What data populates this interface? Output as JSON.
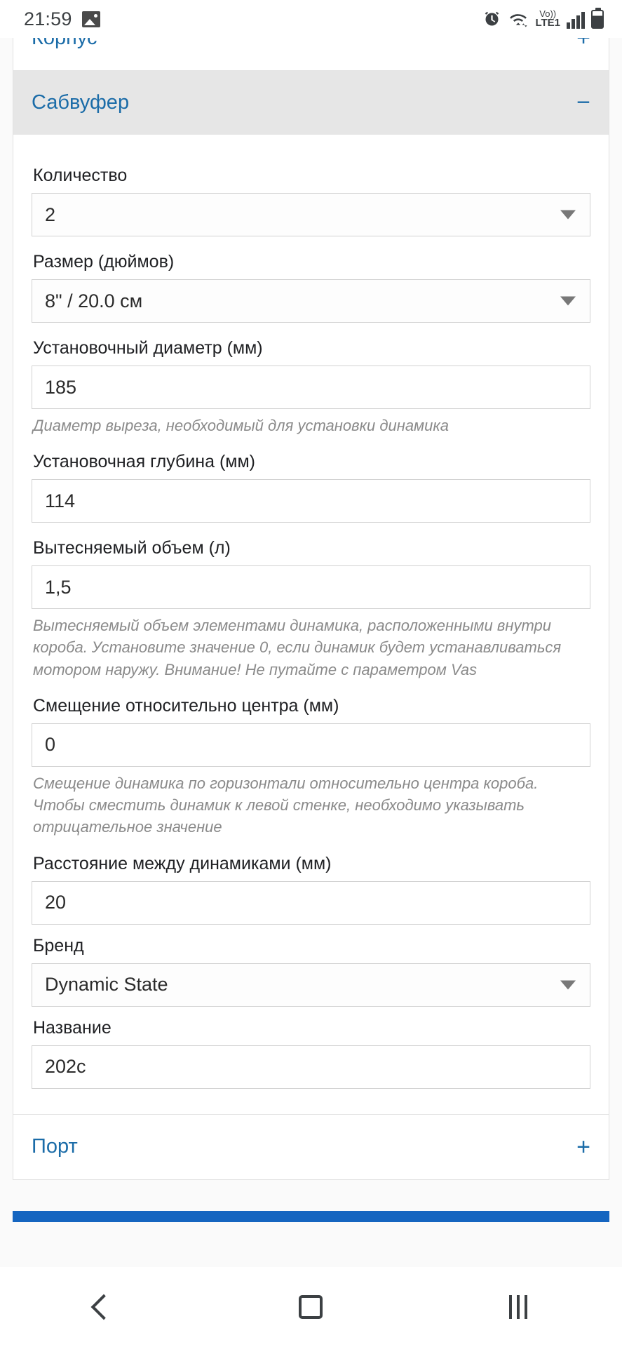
{
  "statusbar": {
    "time": "21:59",
    "icons": [
      "image-icon",
      "alarm-icon",
      "wifi-icon",
      "volte-icon",
      "signal-icon",
      "battery-icon"
    ],
    "volte_top": "Vo))",
    "volte_bottom": "LTE1"
  },
  "panels": {
    "enclosure": {
      "title": "Корпус",
      "sign": "+"
    },
    "subwoofer": {
      "title": "Сабвуфер",
      "sign": "−"
    },
    "port": {
      "title": "Порт",
      "sign": "+"
    }
  },
  "fields": {
    "quantity": {
      "label": "Количество",
      "value": "2",
      "type": "select"
    },
    "size": {
      "label": "Размер (дюймов)",
      "value": "8\" / 20.0 см",
      "type": "select"
    },
    "mount_diameter": {
      "label": "Установочный диаметр (мм)",
      "value": "185",
      "type": "text",
      "hint": "Диаметр выреза, необходимый для установки динамика"
    },
    "mount_depth": {
      "label": "Установочная глубина (мм)",
      "value": "114",
      "type": "text"
    },
    "displaced_volume": {
      "label": "Вытесняемый объем (л)",
      "value": "1,5",
      "type": "text",
      "hint": "Вытесняемый объем элементами динамика, расположенными внутри короба. Установите значение 0, если динамик будет устанавливаться мотором наружу. Внимание! Не путайте с параметром Vas"
    },
    "center_offset": {
      "label": "Смещение относительно центра (мм)",
      "value": "0",
      "type": "text",
      "hint": "Смещение динамика по горизонтали относительно центра короба. Чтобы сместить динамик к левой стенке, необходимо указывать отрицательное значение"
    },
    "driver_spacing": {
      "label": "Расстояние между динамиками (мм)",
      "value": "20",
      "type": "text"
    },
    "brand": {
      "label": "Бренд",
      "value": "Dynamic State",
      "type": "select"
    },
    "model_name": {
      "label": "Название",
      "value": "202c",
      "type": "text"
    }
  },
  "navbar": {
    "back": "back-icon",
    "home": "home-icon",
    "recents": "recents-icon"
  },
  "colors": {
    "accent": "#1b6ca8",
    "panel_active_bg": "#e6e6e6",
    "hint_text": "#8a8a8a",
    "bottom_bar": "#1565c0"
  }
}
